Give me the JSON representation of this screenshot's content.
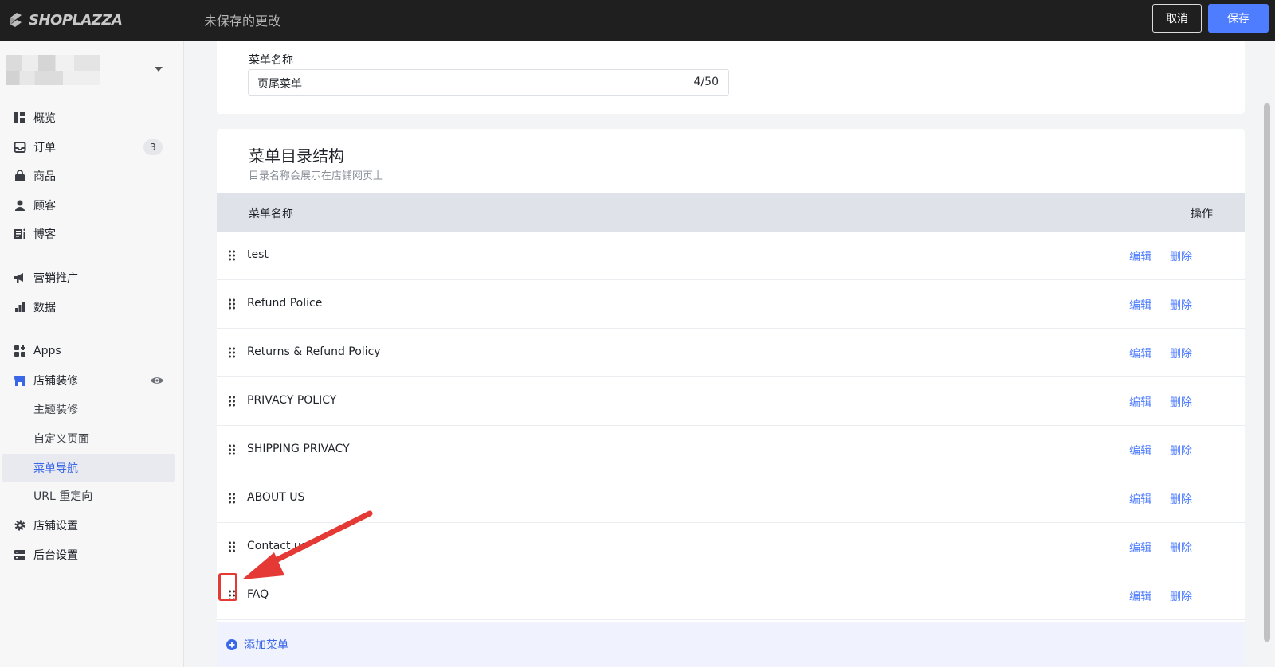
{
  "app": {
    "logo_text": "SHOPLAZZA",
    "unsaved_text": "未保存的更改",
    "cancel_label": "取消",
    "save_label": "保存",
    "accent_color": "#4f7dff"
  },
  "sidebar": {
    "items": [
      {
        "label": "概览",
        "icon": "dashboard-icon"
      },
      {
        "label": "订单",
        "icon": "inbox-icon",
        "badge": "3"
      },
      {
        "label": "商品",
        "icon": "shopping-bag-icon"
      },
      {
        "label": "顾客",
        "icon": "person-icon"
      },
      {
        "label": "博客",
        "icon": "blog-icon"
      },
      {
        "label": "营销推广",
        "icon": "megaphone-icon"
      },
      {
        "label": "数据",
        "icon": "bar-chart-icon"
      },
      {
        "label": "Apps",
        "icon": "apps-icon"
      },
      {
        "label": "店铺装修",
        "icon": "storefront-icon"
      },
      {
        "label": "主题装修"
      },
      {
        "label": "自定义页面"
      },
      {
        "label": "菜单导航",
        "active": true
      },
      {
        "label": "URL 重定向"
      },
      {
        "label": "店铺设置",
        "icon": "gear-icon"
      },
      {
        "label": "后台设置",
        "icon": "server-icon"
      }
    ]
  },
  "menu_form": {
    "name_label": "菜单名称",
    "name_value": "页尾菜单",
    "char_count": "4/50"
  },
  "menu_structure": {
    "title": "菜单目录结构",
    "subtitle": "目录名称会展示在店铺网页上",
    "col_name": "菜单名称",
    "col_action": "操作",
    "edit_label": "编辑",
    "delete_label": "删除",
    "rows": [
      {
        "name": "test"
      },
      {
        "name": "Refund Police"
      },
      {
        "name": "Returns & Refund Policy"
      },
      {
        "name": "PRIVACY POLICY"
      },
      {
        "name": "SHIPPING PRIVACY"
      },
      {
        "name": "ABOUT US"
      },
      {
        "name": "Contact us"
      },
      {
        "name": "FAQ"
      }
    ],
    "add_label": "添加菜单"
  }
}
